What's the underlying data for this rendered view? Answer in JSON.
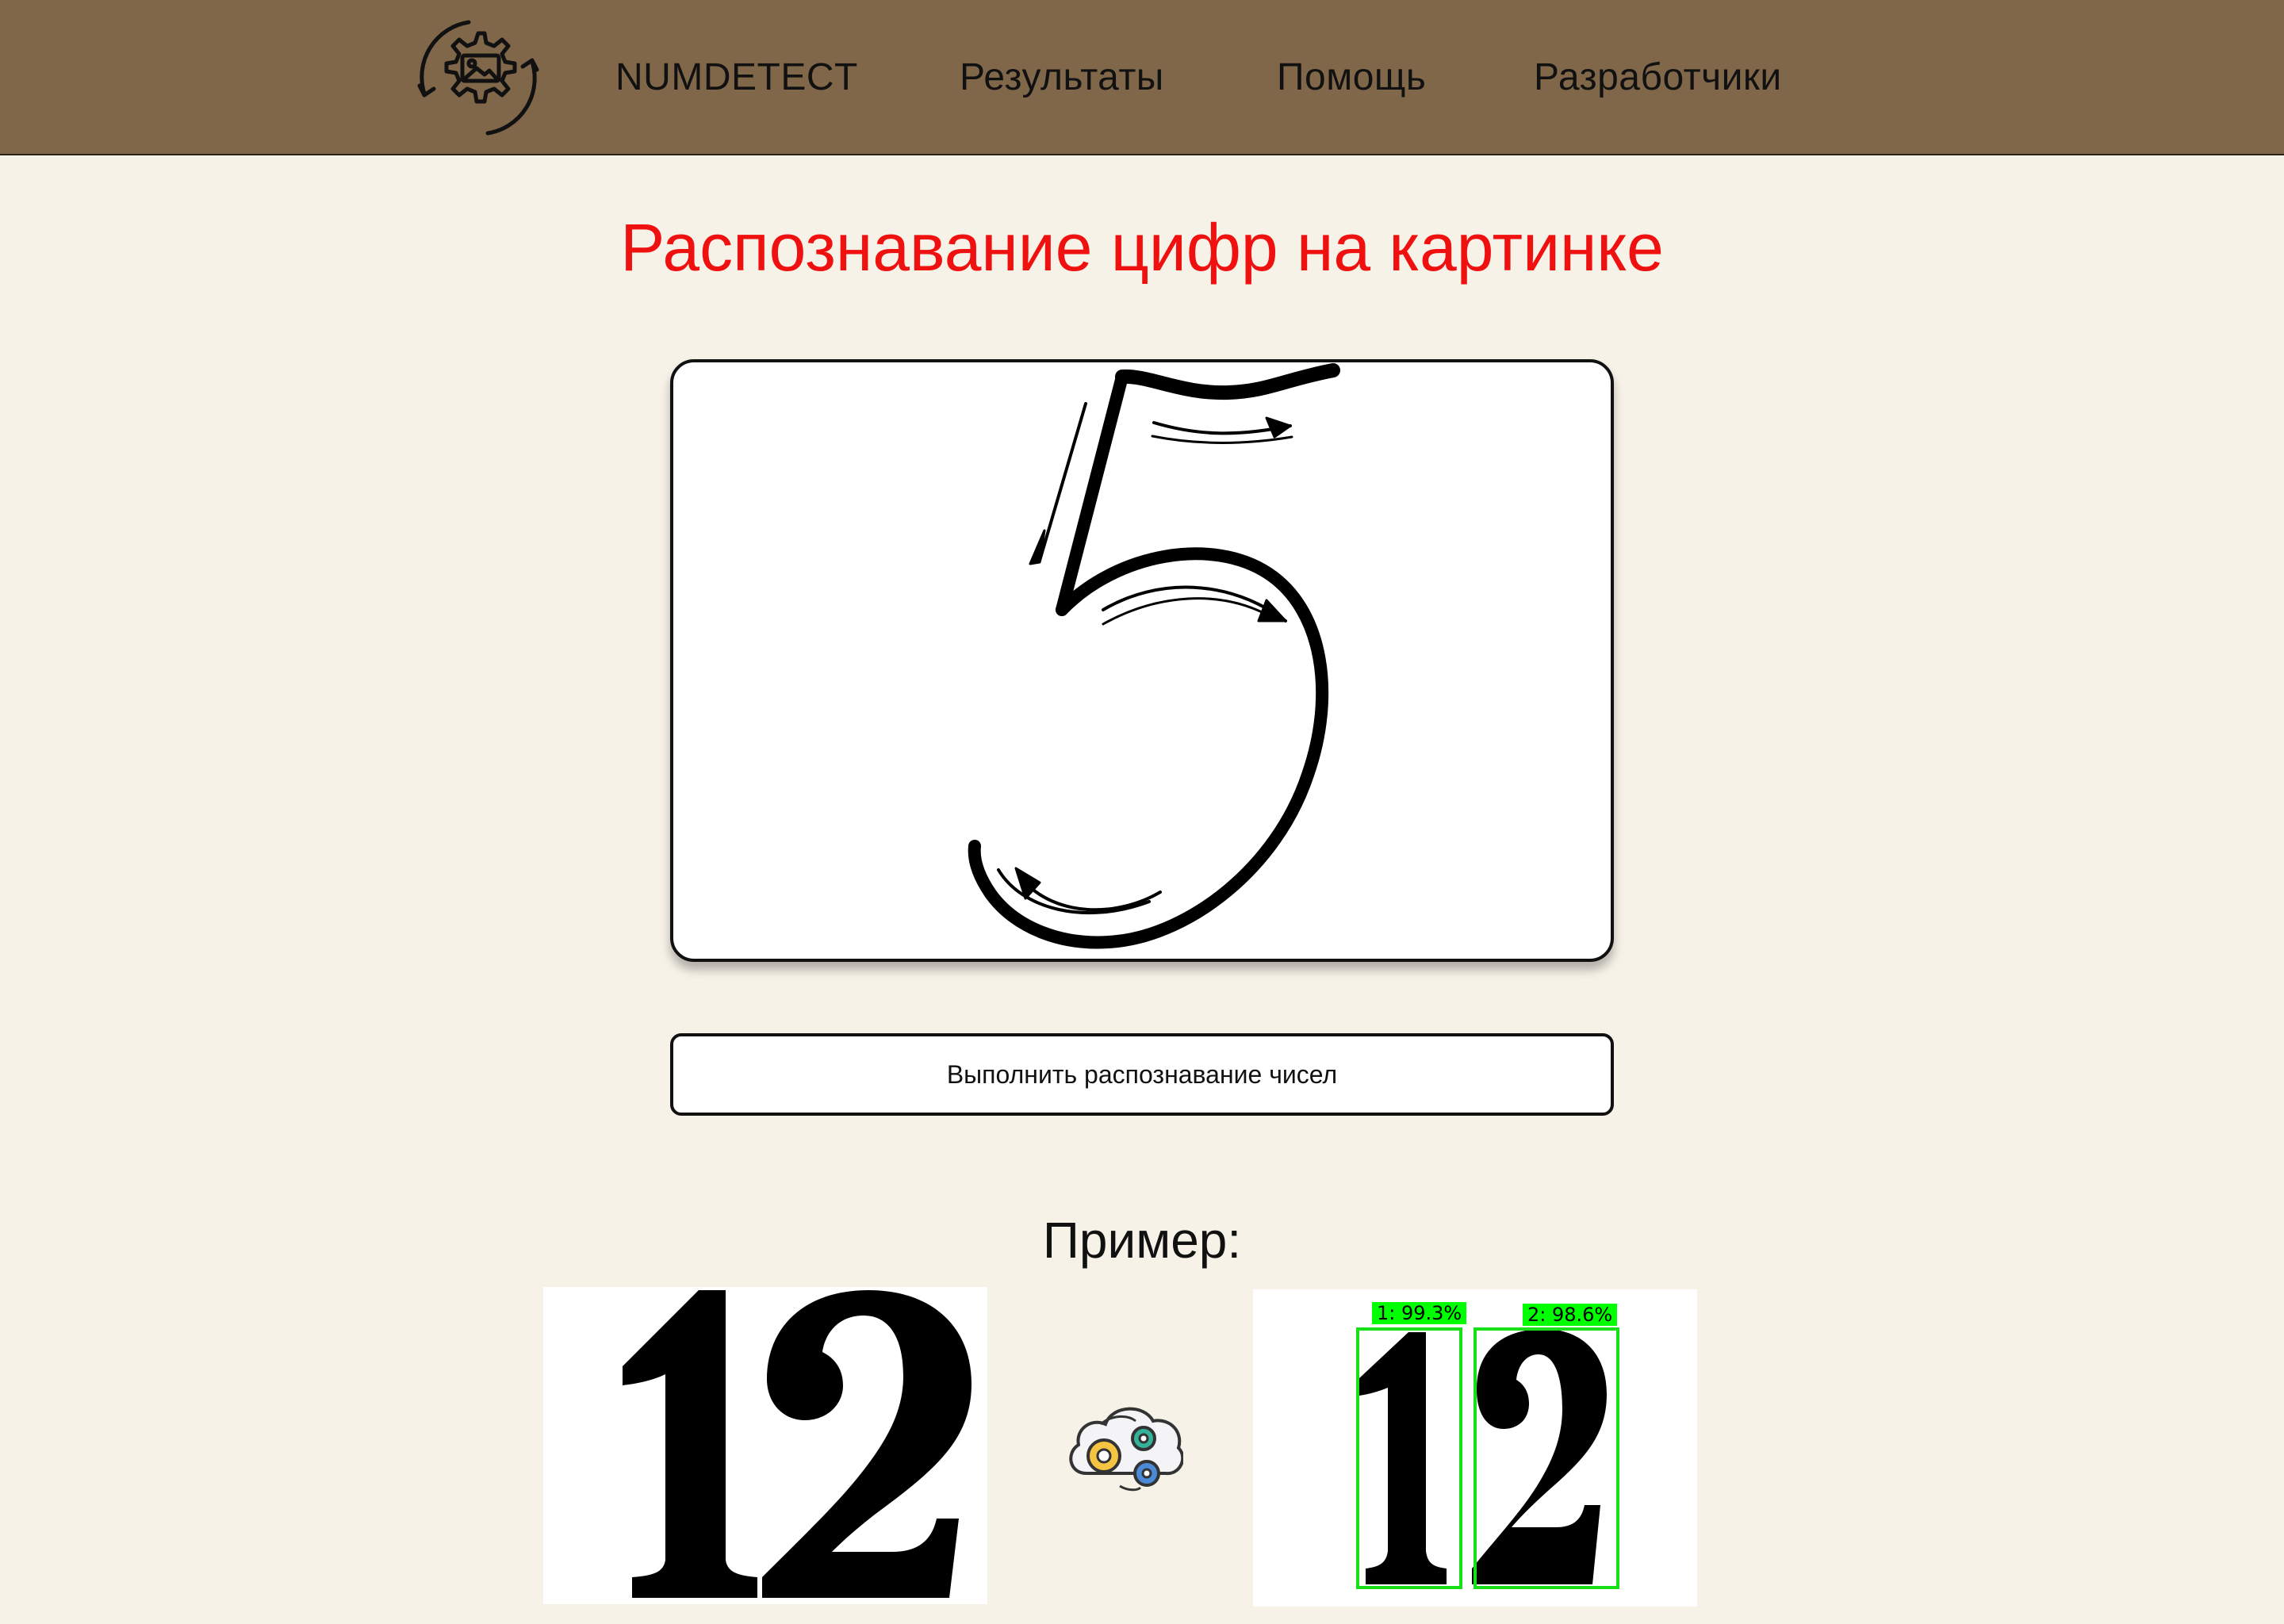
{
  "header": {
    "logo_icon": "gear-image-cycle-icon",
    "brand": "NUMDETECT",
    "nav": {
      "results": "Результаты",
      "help": "Помощь",
      "developers": "Разработчики"
    }
  },
  "main": {
    "title": "Распознавание цифр на картинке",
    "uploaded_image_content": "5",
    "run_button": "Выполнить распознавание чисел"
  },
  "example": {
    "label": "Пример:",
    "input_digits": "12",
    "process_icon": "cloud-gears-icon",
    "detections": [
      {
        "label": "1: 99.3%"
      },
      {
        "label": "2: 98.6%"
      }
    ]
  },
  "colors": {
    "header_bg": "#80674a",
    "page_bg": "#f6f2e8",
    "title": "#ef1010",
    "detection_box": "#18e018",
    "detection_label_bg": "#00ff00"
  }
}
